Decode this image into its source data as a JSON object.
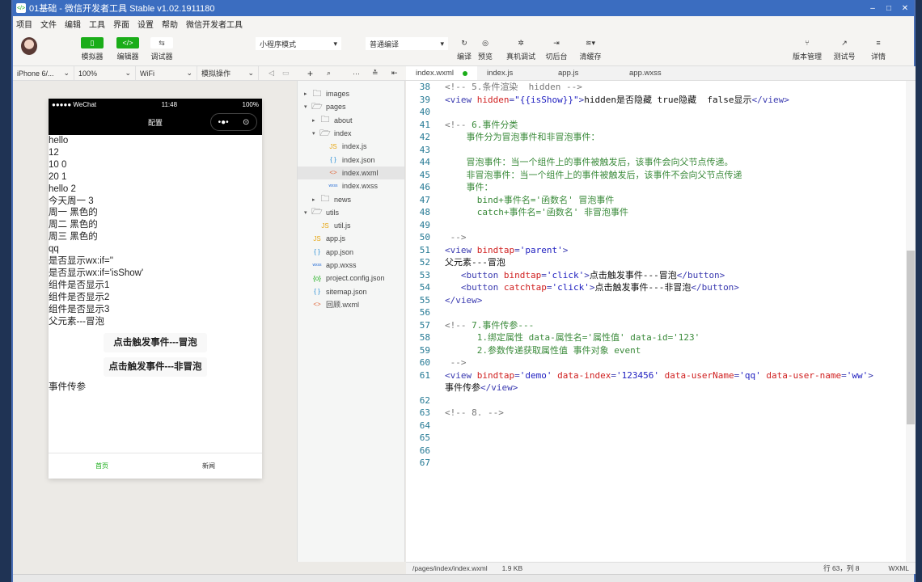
{
  "window": {
    "title": "01基础 - 微信开发者工具 Stable v1.02.1911180",
    "logo": "</>"
  },
  "menu": [
    "项目",
    "文件",
    "编辑",
    "工具",
    "界面",
    "设置",
    "帮助",
    "微信开发者工具"
  ],
  "toolbar": {
    "simulator": "模拟器",
    "editor": "编辑器",
    "debugger": "调试器",
    "mode": "小程序模式",
    "compile_mode": "普通编译",
    "compile": "编译",
    "preview": "预览",
    "remote_debug": "真机调试",
    "background": "切后台",
    "clear_cache": "清缓存",
    "version": "版本管理",
    "test_account": "测试号",
    "details": "详情"
  },
  "subbar": {
    "device": "iPhone 6/...",
    "zoom": "100%",
    "network": "WiFi",
    "operation": "模拟操作"
  },
  "phone": {
    "carrier": "●●●●● WeChat",
    "time": "11:48",
    "battery": "100%",
    "nav_title": "配置",
    "lines": [
      "hello",
      "12",
      "10 0",
      "20 1",
      "hello 2",
      "今天周一 3",
      "周一 黑色的",
      "周二 黑色的",
      "周三 黑色的",
      "qq",
      "是否显示wx:if=''",
      "是否显示wx:if='isShow'",
      "组件是否显示1",
      "组件是否显示2",
      "组件是否显示3",
      "父元素---冒泡"
    ],
    "buttons": [
      "点击触发事件---冒泡",
      "点击触发事件---非冒泡"
    ],
    "after": "事件传参",
    "tabs": [
      "首页",
      "新闻"
    ],
    "active_tab_color": "#1aad19"
  },
  "tree": [
    {
      "name": "images",
      "type": "folder",
      "depth": 0,
      "open": false
    },
    {
      "name": "pages",
      "type": "folder",
      "depth": 0,
      "open": true
    },
    {
      "name": "about",
      "type": "folder",
      "depth": 1,
      "open": false
    },
    {
      "name": "index",
      "type": "folder",
      "depth": 1,
      "open": true
    },
    {
      "name": "index.js",
      "type": "js",
      "depth": 2
    },
    {
      "name": "index.json",
      "type": "json",
      "depth": 2
    },
    {
      "name": "index.wxml",
      "type": "wxml",
      "depth": 2,
      "selected": true
    },
    {
      "name": "index.wxss",
      "type": "wxss",
      "depth": 2
    },
    {
      "name": "news",
      "type": "folder",
      "depth": 1,
      "open": false
    },
    {
      "name": "utils",
      "type": "folder",
      "depth": 0,
      "open": true
    },
    {
      "name": "util.js",
      "type": "js",
      "depth": 1
    },
    {
      "name": "app.js",
      "type": "js",
      "depth": 0
    },
    {
      "name": "app.json",
      "type": "json",
      "depth": 0
    },
    {
      "name": "app.wxss",
      "type": "wxss",
      "depth": 0
    },
    {
      "name": "project.config.json",
      "type": "config",
      "depth": 0
    },
    {
      "name": "sitemap.json",
      "type": "json",
      "depth": 0
    },
    {
      "name": "回顾.wxml",
      "type": "wxml",
      "depth": 0
    }
  ],
  "editor_tabs": [
    {
      "label": "index.wxml",
      "active": true,
      "modified": true
    },
    {
      "label": "index.js"
    },
    {
      "label": "app.js"
    },
    {
      "label": "app.wxss"
    }
  ],
  "code": [
    {
      "n": "38",
      "s": [
        [
          "cmg",
          "<!-- 5.条件渲染  hidden -->"
        ]
      ]
    },
    {
      "n": "39",
      "s": [
        [
          "tag",
          "<view "
        ],
        [
          "attr",
          "hidden"
        ],
        [
          "tag",
          "="
        ],
        [
          "str",
          "\"{{isShow}}\""
        ],
        [
          "tag",
          ">"
        ],
        [
          "txt",
          "hidden是否隐藏 true隐藏  false显示"
        ],
        [
          "tag",
          "</view>"
        ]
      ]
    },
    {
      "n": "40",
      "s": []
    },
    {
      "n": "41",
      "s": [
        [
          "cmg",
          "<!-- "
        ],
        [
          "cmt",
          "6.事件分类"
        ]
      ]
    },
    {
      "n": "42",
      "s": [
        [
          "cmt",
          "    事件分为冒泡事件和非冒泡事件："
        ]
      ]
    },
    {
      "n": "43",
      "s": []
    },
    {
      "n": "44",
      "s": [
        [
          "cmt",
          "    冒泡事件：当一个组件上的事件被触发后，该事件会向父节点传递。"
        ]
      ]
    },
    {
      "n": "45",
      "s": [
        [
          "cmt",
          "    非冒泡事件：当一个组件上的事件被触发后，该事件不会向父节点传递"
        ]
      ]
    },
    {
      "n": "46",
      "s": [
        [
          "cmt",
          "    事件："
        ]
      ]
    },
    {
      "n": "47",
      "s": [
        [
          "cmt",
          "      bind+事件名='函数名' 冒泡事件"
        ]
      ]
    },
    {
      "n": "48",
      "s": [
        [
          "cmt",
          "      catch+事件名='函数名' 非冒泡事件"
        ]
      ]
    },
    {
      "n": "49",
      "s": []
    },
    {
      "n": "50",
      "s": [
        [
          "cmg",
          " -->"
        ]
      ]
    },
    {
      "n": "51",
      "s": [
        [
          "tag",
          "<view "
        ],
        [
          "attr",
          "bindtap"
        ],
        [
          "tag",
          "="
        ],
        [
          "str",
          "'parent'"
        ],
        [
          "tag",
          ">"
        ]
      ]
    },
    {
      "n": "52",
      "s": [
        [
          "txt",
          "父元素---冒泡"
        ]
      ]
    },
    {
      "n": "53",
      "s": [
        [
          "tag",
          "   <button "
        ],
        [
          "attr",
          "bindtap"
        ],
        [
          "tag",
          "="
        ],
        [
          "str",
          "'click'"
        ],
        [
          "tag",
          ">"
        ],
        [
          "txt",
          "点击触发事件---冒泡"
        ],
        [
          "tag",
          "</button>"
        ]
      ]
    },
    {
      "n": "54",
      "s": [
        [
          "tag",
          "   <button "
        ],
        [
          "attr",
          "catchtap"
        ],
        [
          "tag",
          "="
        ],
        [
          "str",
          "'click'"
        ],
        [
          "tag",
          ">"
        ],
        [
          "txt",
          "点击触发事件---非冒泡"
        ],
        [
          "tag",
          "</button>"
        ]
      ]
    },
    {
      "n": "55",
      "s": [
        [
          "tag",
          "</view>"
        ]
      ]
    },
    {
      "n": "56",
      "s": []
    },
    {
      "n": "57",
      "s": [
        [
          "cmg",
          "<!-- "
        ],
        [
          "cmt",
          "7.事件传参---"
        ]
      ]
    },
    {
      "n": "58",
      "s": [
        [
          "cmt",
          "      1.绑定属性 data-属性名='属性值' data-id='123'"
        ]
      ]
    },
    {
      "n": "59",
      "s": [
        [
          "cmt",
          "      2.参数传递获取属性值 事件对象 event"
        ]
      ]
    },
    {
      "n": "60",
      "s": [
        [
          "cmg",
          " -->"
        ]
      ]
    },
    {
      "n": "61",
      "s": [
        [
          "tag",
          "<view "
        ],
        [
          "attr",
          "bindtap"
        ],
        [
          "tag",
          "="
        ],
        [
          "str",
          "'demo'"
        ],
        [
          "tag",
          " "
        ],
        [
          "attr",
          "data-index"
        ],
        [
          "tag",
          "="
        ],
        [
          "str",
          "'123456'"
        ],
        [
          "tag",
          " "
        ],
        [
          "attr",
          "data-userName"
        ],
        [
          "tag",
          "="
        ],
        [
          "str",
          "'qq'"
        ],
        [
          "tag",
          " "
        ],
        [
          "attr",
          "data-user-name"
        ],
        [
          "tag",
          "="
        ],
        [
          "str",
          "'ww'"
        ],
        [
          "tag",
          ">"
        ]
      ]
    },
    {
      "n": "",
      "s": [
        [
          "txt",
          "事件传参"
        ],
        [
          "tag",
          "</view>"
        ]
      ]
    },
    {
      "n": "62",
      "s": []
    },
    {
      "n": "63",
      "s": [
        [
          "cmg",
          "<!-- 8. -->"
        ]
      ]
    },
    {
      "n": "64",
      "s": []
    },
    {
      "n": "65",
      "s": []
    },
    {
      "n": "66",
      "s": []
    },
    {
      "n": "67",
      "s": []
    }
  ],
  "status": {
    "path": "/pages/index/index.wxml",
    "size": "1.9 KB",
    "cursor": "行 63，列 8",
    "lang": "WXML"
  }
}
